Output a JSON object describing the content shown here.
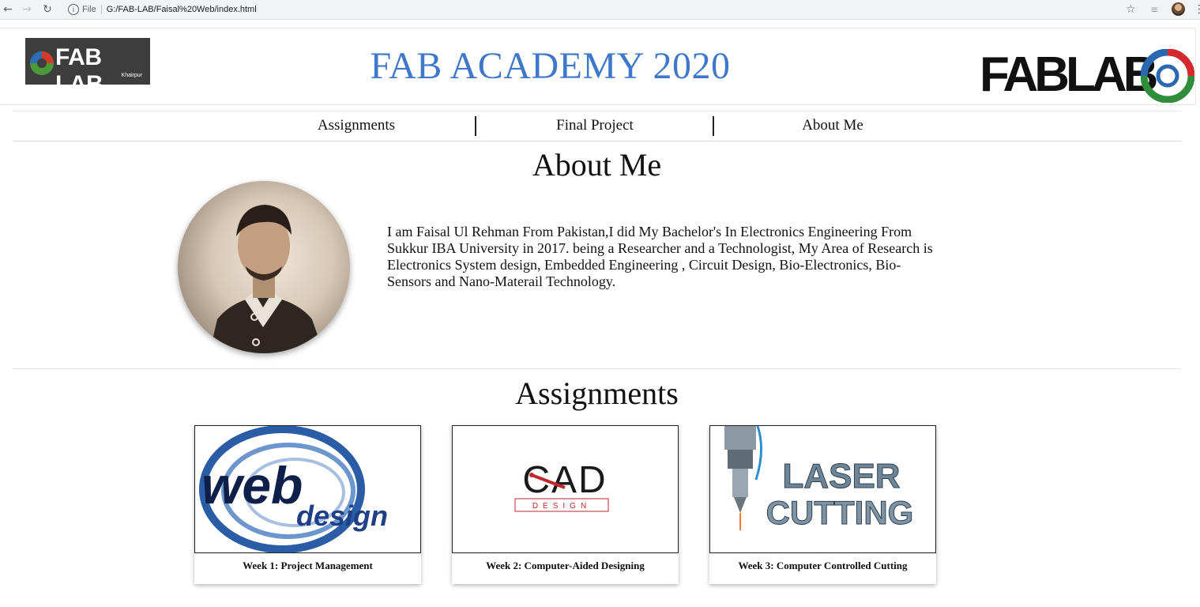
{
  "browser": {
    "file_label": "File",
    "url": "G:/FAB-LAB/Faisal%20Web/index.html"
  },
  "header": {
    "title": "FAB ACADEMY 2020",
    "logo_left_text": "FAB LAB",
    "logo_left_sub": "Khairpur",
    "logo_right_text": "FABLAB"
  },
  "nav": {
    "items": [
      "Assignments",
      "Final Project",
      "About Me"
    ]
  },
  "about": {
    "heading": "About Me",
    "bio": "I am Faisal Ul Rehman From Pakistan,I did My Bachelor's In Electronics Engineering From Sukkur IBA University in 2017. being a Researcher and a Technologist, My Area of  Research is Electronics System design, Embedded Engineering , Circuit Design, Bio-Electronics, Bio-Sensors and Nano-Materail Technology."
  },
  "assignments": {
    "heading": "Assignments",
    "cards": [
      {
        "caption": "Week 1: Project Management",
        "image_text": [
          "web",
          "design"
        ]
      },
      {
        "caption": "Week 2: Computer-Aided Designing",
        "image_text": [
          "CAD",
          "DESIGN"
        ]
      },
      {
        "caption": "Week 3: Computer Controlled Cutting",
        "image_text": [
          "LASER",
          "CUTTING"
        ]
      }
    ]
  },
  "colors": {
    "title_blue": "#3f77c9",
    "cad_red": "#c0272d",
    "laser_steel": "#6e8597"
  }
}
